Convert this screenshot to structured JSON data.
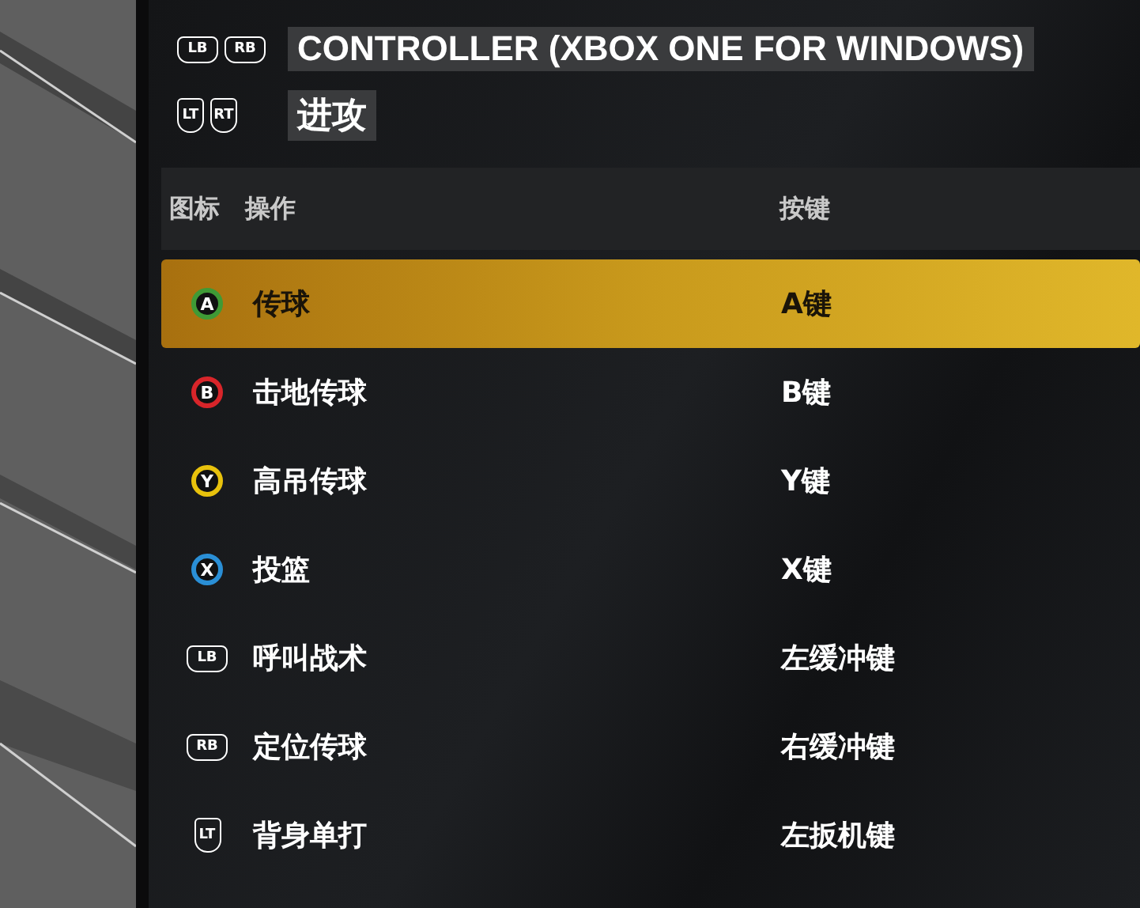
{
  "header": {
    "rows": [
      {
        "buttons": [
          {
            "kind": "bumper",
            "label": "LB"
          },
          {
            "kind": "bumper",
            "label": "RB"
          }
        ],
        "title": "CONTROLLER (XBOX ONE FOR WINDOWS)"
      },
      {
        "buttons": [
          {
            "kind": "trigger",
            "label": "LT"
          },
          {
            "kind": "trigger",
            "label": "RT"
          }
        ],
        "title": "进攻"
      }
    ]
  },
  "table": {
    "columns": [
      "图标",
      "操作",
      "按键"
    ],
    "rows": [
      {
        "icon": {
          "kind": "face",
          "label": "A",
          "color": "#3f9a36"
        },
        "action": "传球",
        "key": "A键",
        "selected": true
      },
      {
        "icon": {
          "kind": "face",
          "label": "B",
          "color": "#d8252a"
        },
        "action": "击地传球",
        "key": "B键",
        "selected": false
      },
      {
        "icon": {
          "kind": "face",
          "label": "Y",
          "color": "#e8c20c"
        },
        "action": "高吊传球",
        "key": "Y键",
        "selected": false
      },
      {
        "icon": {
          "kind": "face",
          "label": "X",
          "color": "#2a8fd6"
        },
        "action": "投篮",
        "key": "X键",
        "selected": false
      },
      {
        "icon": {
          "kind": "bumper",
          "label": "LB"
        },
        "action": "呼叫战术",
        "key": "左缓冲键",
        "selected": false
      },
      {
        "icon": {
          "kind": "bumper",
          "label": "RB"
        },
        "action": "定位传球",
        "key": "右缓冲键",
        "selected": false
      },
      {
        "icon": {
          "kind": "trigger",
          "label": "LT"
        },
        "action": "背身单打",
        "key": "左扳机键",
        "selected": false
      }
    ]
  }
}
